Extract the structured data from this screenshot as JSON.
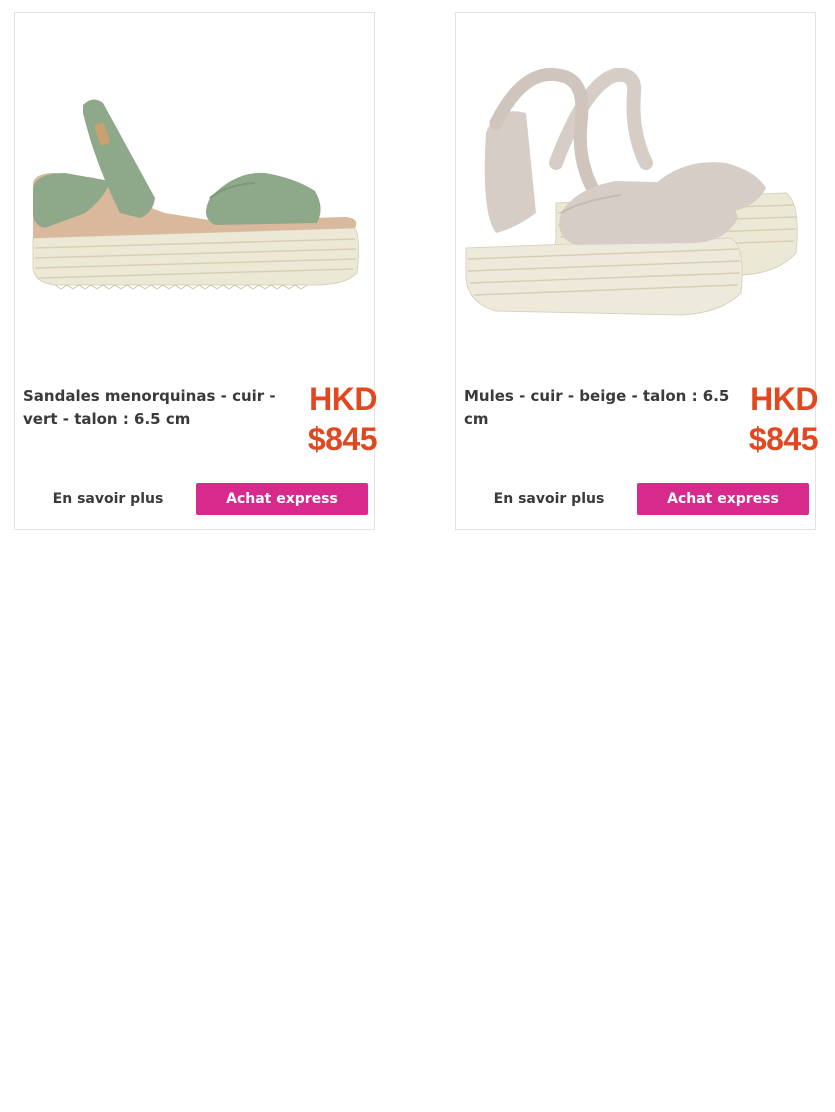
{
  "products": [
    {
      "title": "Sandales menorquinas - cuir - vert - talon : 6.5 cm",
      "price_currency": "HKD",
      "price_amount": "$845",
      "more_label": "En savoir plus",
      "buy_label": "Achat express",
      "image_icon": "green-wedge-sandal",
      "colors": {
        "upper": "#8ea98a",
        "sole": "#ece8d6"
      }
    },
    {
      "title": "Mules - cuir - beige - talon : 6.5 cm",
      "price_currency": "HKD",
      "price_amount": "$845",
      "more_label": "En savoir plus",
      "buy_label": "Achat express",
      "image_icon": "beige-wedge-sandal-pair",
      "colors": {
        "upper": "#d6cdc6",
        "sole": "#ece8d6"
      }
    }
  ],
  "colors": {
    "accent": "#d72a8c",
    "price": "#e2471f",
    "text": "#3a3a3a",
    "border": "#e2e2e2"
  }
}
